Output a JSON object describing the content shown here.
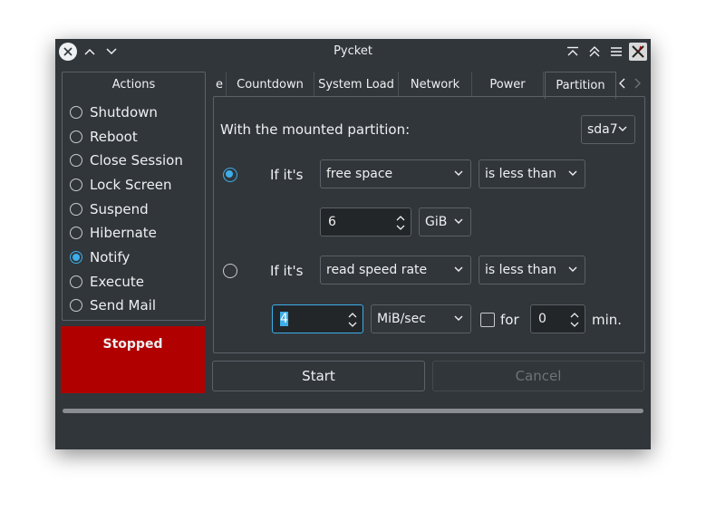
{
  "window": {
    "title": "Pycket"
  },
  "actions": {
    "title": "Actions",
    "items": [
      {
        "label": "Shutdown",
        "checked": false
      },
      {
        "label": "Reboot",
        "checked": false
      },
      {
        "label": "Close Session",
        "checked": false
      },
      {
        "label": "Lock Screen",
        "checked": false
      },
      {
        "label": "Suspend",
        "checked": false
      },
      {
        "label": "Hibernate",
        "checked": false
      },
      {
        "label": "Notify",
        "checked": true
      },
      {
        "label": "Execute",
        "checked": false
      },
      {
        "label": "Send Mail",
        "checked": false
      }
    ]
  },
  "status": {
    "label": "Stopped",
    "color": "#b00000"
  },
  "tabs": [
    {
      "label": "e"
    },
    {
      "label": "Countdown"
    },
    {
      "label": "System Load"
    },
    {
      "label": "Network"
    },
    {
      "label": "Power"
    },
    {
      "label": "Partition",
      "active": true
    }
  ],
  "partition": {
    "mounted_label": "With the mounted partition:",
    "partition_value": "sda7",
    "row1": {
      "if_label": "If it's",
      "metric": "free space",
      "comparison": "is less than",
      "value": "6",
      "unit": "GiB",
      "selected": true
    },
    "row2": {
      "if_label": "If it's",
      "metric": "read speed rate",
      "comparison": "is less than",
      "value": "4",
      "unit": "MiB/sec",
      "for_label": "for",
      "for_checked": false,
      "minutes": "0",
      "min_label": "min.",
      "selected": false
    }
  },
  "buttons": {
    "start": "Start",
    "cancel": "Cancel"
  },
  "colors": {
    "accent": "#3daee9",
    "background": "#31363b",
    "text": "#eff0f1"
  }
}
